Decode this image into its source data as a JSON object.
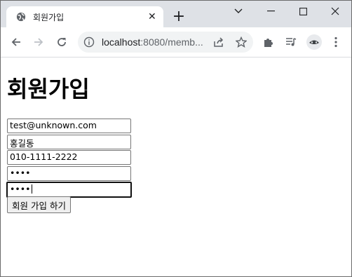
{
  "browser": {
    "tab_title": "회원가입",
    "tab_close": "✕",
    "new_tab": "+",
    "url_host": "localhost",
    "url_rest": ":8080/memb..."
  },
  "page": {
    "heading": "회원가입",
    "fields": {
      "email": "test@unknown.com",
      "name": "홍길동",
      "phone": "010-1111-2222",
      "password": "••••",
      "password_confirm": "••••"
    },
    "submit_label": "회원 가입 하기"
  },
  "icons": {
    "favicon": "globe-icon",
    "back": "back-arrow-icon",
    "forward": "forward-arrow-icon",
    "reload": "reload-icon",
    "info": "info-icon",
    "share": "share-icon",
    "bookmark": "star-icon",
    "extensions": "puzzle-icon",
    "media": "media-queue-icon",
    "profile": "profile-avatar",
    "menu": "kebab-menu-icon"
  },
  "colors": {
    "tabstrip": "#dee1e6",
    "omnibox": "#f1f3f4",
    "button": "#efefef"
  }
}
